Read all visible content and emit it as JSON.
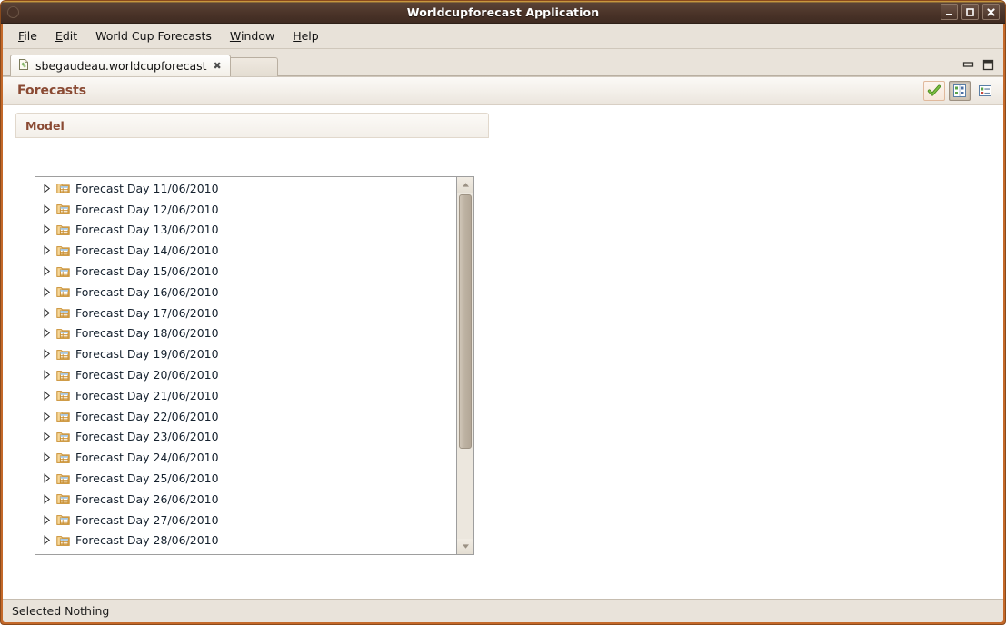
{
  "window": {
    "title": "Worldcupforecast Application",
    "controls": [
      {
        "name": "minimize",
        "glyph": "–"
      },
      {
        "name": "maximize",
        "glyph": "□"
      },
      {
        "name": "close",
        "glyph": "✕"
      }
    ]
  },
  "menubar": {
    "items": [
      {
        "name": "file",
        "mnemonic": "F",
        "rest": "ile"
      },
      {
        "name": "edit",
        "mnemonic": "E",
        "rest": "dit"
      },
      {
        "name": "world-cup-forecasts",
        "mnemonic": "",
        "rest": "World Cup Forecasts"
      },
      {
        "name": "window",
        "mnemonic": "W",
        "rest": "indow"
      },
      {
        "name": "help",
        "mnemonic": "H",
        "rest": "elp"
      }
    ]
  },
  "tabs": {
    "active": {
      "label": "sbegaudeau.worldcupforecast",
      "icon": "emf-document-icon",
      "close_glyph": "✖"
    }
  },
  "editor_controls": {
    "minimize_tooltip": "Minimize",
    "maximize_tooltip": "Maximize"
  },
  "form": {
    "title": "Forecasts",
    "tools": [
      {
        "name": "validate-button",
        "icon": "green-check-icon",
        "selected": false
      },
      {
        "name": "properties-button",
        "icon": "properties-grid-icon",
        "selected": true
      },
      {
        "name": "form-view-button",
        "icon": "list-form-icon",
        "selected": false
      }
    ],
    "section": {
      "title": "Model"
    }
  },
  "tree": {
    "expander_icon": "triangle-right-icon",
    "node_icon": "table-node-icon",
    "items": [
      {
        "label": "Forecast Day 11/06/2010"
      },
      {
        "label": "Forecast Day 12/06/2010"
      },
      {
        "label": "Forecast Day 13/06/2010"
      },
      {
        "label": "Forecast Day 14/06/2010"
      },
      {
        "label": "Forecast Day 15/06/2010"
      },
      {
        "label": "Forecast Day 16/06/2010"
      },
      {
        "label": "Forecast Day 17/06/2010"
      },
      {
        "label": "Forecast Day 18/06/2010"
      },
      {
        "label": "Forecast Day 19/06/2010"
      },
      {
        "label": "Forecast Day 20/06/2010"
      },
      {
        "label": "Forecast Day 21/06/2010"
      },
      {
        "label": "Forecast Day 22/06/2010"
      },
      {
        "label": "Forecast Day 23/06/2010"
      },
      {
        "label": "Forecast Day 24/06/2010"
      },
      {
        "label": "Forecast Day 25/06/2010"
      },
      {
        "label": "Forecast Day 26/06/2010"
      },
      {
        "label": "Forecast Day 27/06/2010"
      },
      {
        "label": "Forecast Day 28/06/2010"
      }
    ]
  },
  "scrollbar": {
    "up_glyph": "▲",
    "down_glyph": "▼"
  },
  "statusbar": {
    "text": "Selected Nothing"
  },
  "colors": {
    "frame": "#c4692a",
    "titlebar": "#4a3328",
    "accent_heading": "#8a4a33",
    "node_icon": "#f0b860"
  }
}
